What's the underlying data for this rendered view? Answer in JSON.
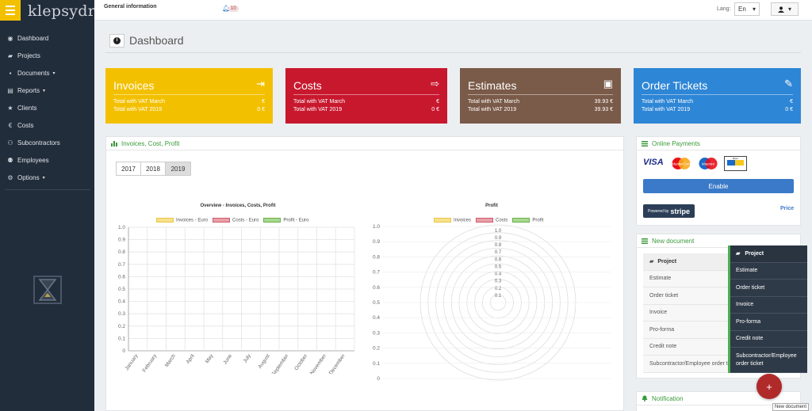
{
  "app": {
    "logo_text": "klepsydra"
  },
  "topbar": {
    "title": "General information",
    "notifications_count": "10",
    "lang_label": "Lang:",
    "lang_value": "En",
    "lang_caret": "▾",
    "user_caret": "▾"
  },
  "sidebar": {
    "items": [
      {
        "label": "Dashboard",
        "icon": "◉",
        "caret": ""
      },
      {
        "label": "Projects",
        "icon": "▰",
        "caret": ""
      },
      {
        "label": "Documents",
        "icon": "▪",
        "caret": "▾"
      },
      {
        "label": "Reports",
        "icon": "▤",
        "caret": "▾"
      },
      {
        "label": "Clients",
        "icon": "★",
        "caret": ""
      },
      {
        "label": "Costs",
        "icon": "€",
        "caret": ""
      },
      {
        "label": "Subcontractors",
        "icon": "⚇",
        "caret": ""
      },
      {
        "label": "Employees",
        "icon": "⚉",
        "caret": ""
      },
      {
        "label": "Options",
        "icon": "⚙",
        "caret": "▾"
      }
    ]
  },
  "page": {
    "title": "Dashboard",
    "info_icon": "i"
  },
  "cards": [
    {
      "title": "Invoices",
      "icon": "⇥",
      "row1_label": "Total with VAT March",
      "row1_value": "€",
      "row2_label": "Total with VAT 2019",
      "row2_value": "0 €",
      "color": "#f3c000"
    },
    {
      "title": "Costs",
      "icon": "⇨",
      "row1_label": "Total with VAT March",
      "row1_value": "€",
      "row2_label": "Total with VAT 2019",
      "row2_value": "0 €",
      "color": "#c8182e"
    },
    {
      "title": "Estimates",
      "icon": "▣",
      "row1_label": "Total with VAT March",
      "row1_value": "39.93 €",
      "row2_label": "Total with VAT 2019",
      "row2_value": "39.93 €",
      "color": "#7a5a48"
    },
    {
      "title": "Order Tickets",
      "icon": "✎",
      "row1_label": "Total with VAT March",
      "row1_value": "€",
      "row2_label": "Total with VAT 2019",
      "row2_value": "0 €",
      "color": "#2e86d6"
    }
  ],
  "main_panel": {
    "title": "Invoices, Cost, Profit",
    "years": [
      "2017",
      "2018",
      "2019"
    ],
    "selected_year": "2019"
  },
  "chart_data": [
    {
      "type": "bar",
      "title": "Overview - Invoices, Costs, Profit",
      "categories": [
        "January",
        "February",
        "March",
        "April",
        "May",
        "June",
        "July",
        "August",
        "September",
        "October",
        "November",
        "December"
      ],
      "series": [
        {
          "name": "Invoices - Euro",
          "values": [
            0,
            0,
            0,
            0,
            0,
            0,
            0,
            0,
            0,
            0,
            0,
            0
          ],
          "color": "#f7e08a"
        },
        {
          "name": "Costs - Euro",
          "values": [
            0,
            0,
            0,
            0,
            0,
            0,
            0,
            0,
            0,
            0,
            0,
            0
          ],
          "color": "#e8a0a8"
        },
        {
          "name": "Profit - Euro",
          "values": [
            0,
            0,
            0,
            0,
            0,
            0,
            0,
            0,
            0,
            0,
            0,
            0
          ],
          "color": "#a8d890"
        }
      ],
      "ylim": [
        0,
        1
      ],
      "yticks": [
        "0",
        "0.1",
        "0.2",
        "0.3",
        "0.4",
        "0.5",
        "0.6",
        "0.7",
        "0.8",
        "0.9",
        "1.0"
      ],
      "grid": true,
      "legend": "top"
    },
    {
      "type": "polar",
      "title": "Profit",
      "series": [
        {
          "name": "Invoices",
          "color": "#f7e08a"
        },
        {
          "name": "Costs",
          "color": "#e8a0a8"
        },
        {
          "name": "Profit",
          "color": "#a8d890"
        }
      ],
      "rlim": [
        0,
        1
      ],
      "rticks": [
        "0",
        "0.1",
        "0.2",
        "0.3",
        "0.4",
        "0.5",
        "0.6",
        "0.7",
        "0.8",
        "0.9",
        "1.0"
      ],
      "left_ticks": [
        "0",
        "0.1",
        "0.2",
        "0.3",
        "0.4",
        "0.5",
        "0.6",
        "0.7",
        "0.8",
        "0.9",
        "1.0"
      ],
      "legend": "top"
    }
  ],
  "online_payments": {
    "title": "Online Payments",
    "enable_label": "Enable",
    "stripe_prefix": "Powered by",
    "stripe_word": "stripe",
    "price_label": "Price",
    "logos": [
      "VISA",
      "MasterCard",
      "Maestro",
      "Banc"
    ]
  },
  "new_document": {
    "title": "New document",
    "head": "Project",
    "items": [
      "Estimate",
      "Order ticket",
      "Invoice",
      "Pro-forma",
      "Credit note",
      "Subcontractor/Employee order ticket"
    ]
  },
  "dropdown": {
    "head": "Project",
    "items": [
      "Estimate",
      "Order ticket",
      "Invoice",
      "Pro-forma",
      "Credit note",
      "Subcontractor/Employee order ticket"
    ]
  },
  "notification": {
    "title": "Notification"
  },
  "fab": {
    "label": "+",
    "tooltip": "New document"
  }
}
